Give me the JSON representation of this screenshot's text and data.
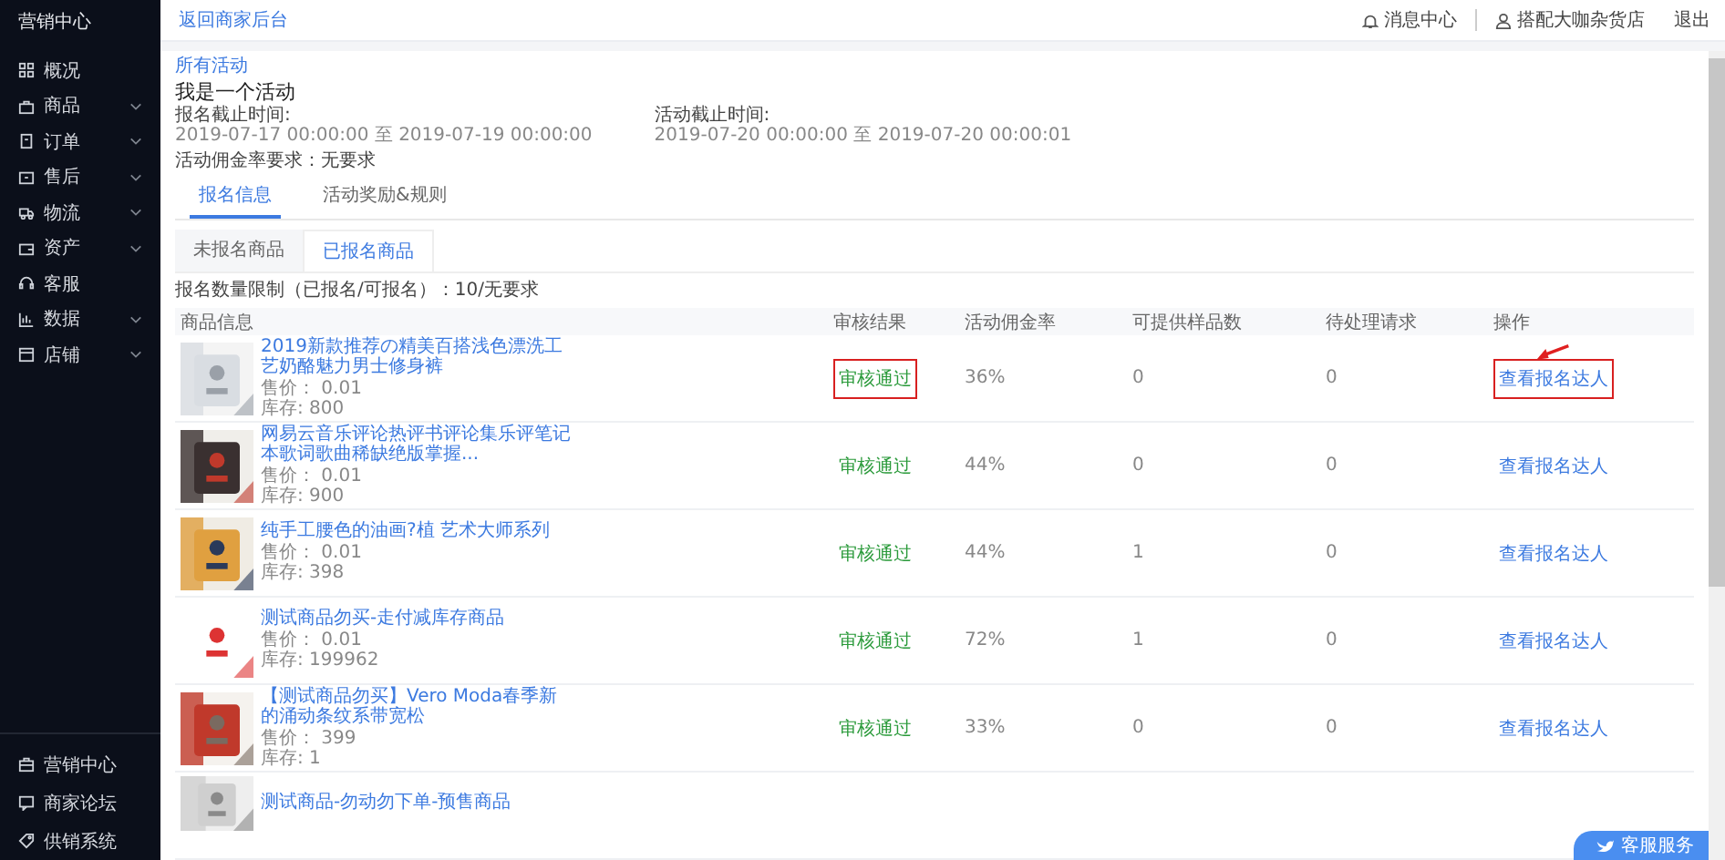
{
  "sidebar": {
    "title": "营销中心",
    "items": [
      {
        "label": "概况",
        "expandable": false
      },
      {
        "label": "商品",
        "expandable": true
      },
      {
        "label": "订单",
        "expandable": true
      },
      {
        "label": "售后",
        "expandable": true
      },
      {
        "label": "物流",
        "expandable": true
      },
      {
        "label": "资产",
        "expandable": true
      },
      {
        "label": "客服",
        "expandable": false
      },
      {
        "label": "数据",
        "expandable": true
      },
      {
        "label": "店铺",
        "expandable": true
      }
    ],
    "bottom_items": [
      {
        "label": "营销中心"
      },
      {
        "label": "商家论坛"
      },
      {
        "label": "供销系统"
      }
    ]
  },
  "header": {
    "back_link": "返回商家后台",
    "messages": "消息中心",
    "user": "搭配大咖杂货店",
    "logout": "退出"
  },
  "breadcrumb": "所有活动",
  "activity": {
    "title": "我是一个活动",
    "periods": [
      {
        "label": "报名截止时间:",
        "value": "2019-07-17 00:00:00 至 2019-07-19 00:00:00"
      },
      {
        "label": "活动截止时间:",
        "value": "2019-07-20 00:00:00 至 2019-07-20 00:00:01"
      }
    ],
    "commission": "活动佣金率要求：无要求"
  },
  "tabs": [
    {
      "label": "报名信息",
      "selected": true
    },
    {
      "label": "活动奖励&规则",
      "selected": false
    }
  ],
  "subtabs": [
    {
      "label": "未报名商品",
      "selected": false
    },
    {
      "label": "已报名商品",
      "selected": true
    }
  ],
  "limit": "报名数量限制（已报名/可报名）：10/无要求",
  "table": {
    "columns": [
      "商品信息",
      "审核结果",
      "活动佣金率",
      "可提供样品数",
      "待处理请求",
      "操作"
    ],
    "rows": [
      {
        "title": "2019新款推荐の精美百搭浅色漂洗工艺奶酪魅力男士修身裤",
        "price": "售价： 0.01",
        "stock": "库存: 800",
        "status": "审核通过",
        "rate": "36%",
        "samples": "0",
        "requests": "0",
        "action": "查看报名达人",
        "annotated": true
      },
      {
        "title": "网易云音乐评论热评书评论集乐评笔记本歌词歌曲稀缺绝版掌握...",
        "price": "售价： 0.01",
        "stock": "库存: 900",
        "status": "审核通过",
        "rate": "44%",
        "samples": "0",
        "requests": "0",
        "action": "查看报名达人",
        "annotated": false
      },
      {
        "title": "纯手工腰色的油画?植 艺术大师系列",
        "price": "售价： 0.01",
        "stock": "库存: 398",
        "status": "审核通过",
        "rate": "44%",
        "samples": "1",
        "requests": "0",
        "action": "查看报名达人",
        "annotated": false
      },
      {
        "title": "测试商品勿买-走付减库存商品",
        "price": "售价： 0.01",
        "stock": "库存: 199962",
        "status": "审核通过",
        "rate": "72%",
        "samples": "1",
        "requests": "0",
        "action": "查看报名达人",
        "annotated": false
      },
      {
        "title": "【测试商品勿买】Vero Moda春季新的涌动条纹系带宽松",
        "price": "售价： 399",
        "stock": "库存: 1",
        "status": "审核通过",
        "rate": "33%",
        "samples": "0",
        "requests": "0",
        "action": "查看报名达人",
        "annotated": false
      },
      {
        "title": "测试商品-勿动勿下单-预售商品"
      }
    ]
  },
  "service_button": "客服服务"
}
